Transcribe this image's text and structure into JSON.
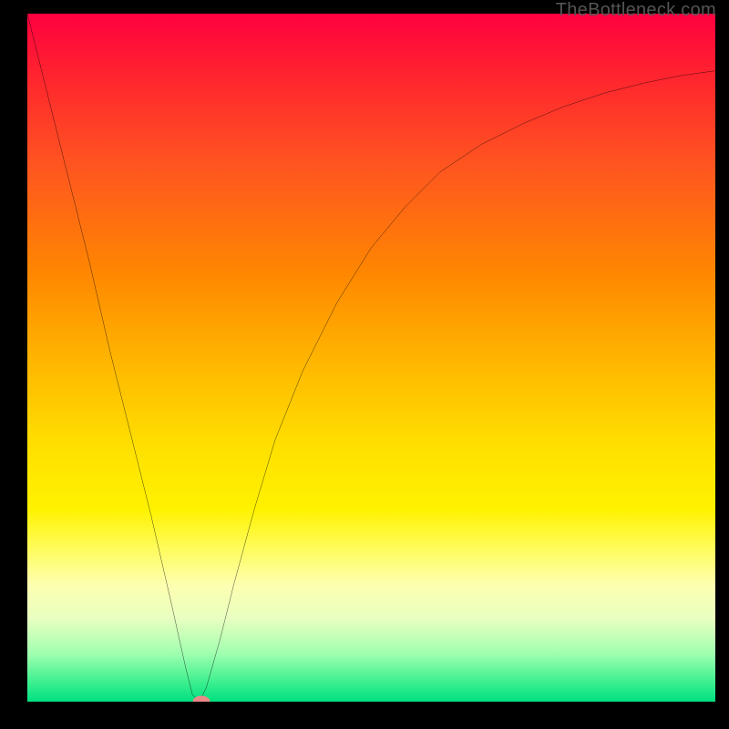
{
  "attribution": "TheBottleneck.com",
  "chart_data": {
    "type": "line",
    "title": "",
    "xlabel": "",
    "ylabel": "",
    "xlim": [
      0,
      100
    ],
    "ylim": [
      0,
      100
    ],
    "grid": false,
    "series": [
      {
        "name": "bottleneck-curve",
        "x": [
          0,
          3,
          6,
          9,
          12,
          15,
          18,
          21,
          23,
          24,
          25,
          26,
          28,
          30,
          33,
          36,
          40,
          45,
          50,
          55,
          60,
          66,
          72,
          78,
          84,
          90,
          95,
          100
        ],
        "values": [
          100,
          88,
          76,
          64,
          51,
          39,
          27,
          14,
          5,
          1,
          0,
          2,
          9,
          17,
          28,
          38,
          48,
          58,
          66,
          72,
          77,
          81,
          84,
          86.5,
          88.5,
          90,
          91,
          91.7
        ]
      }
    ],
    "marker": {
      "x": 25.3,
      "y": 0
    },
    "colors": {
      "top": "#ff0040",
      "bottom": "#00e080",
      "curve": "#000000",
      "marker": "#ec8a87",
      "frame": "#000000"
    }
  }
}
